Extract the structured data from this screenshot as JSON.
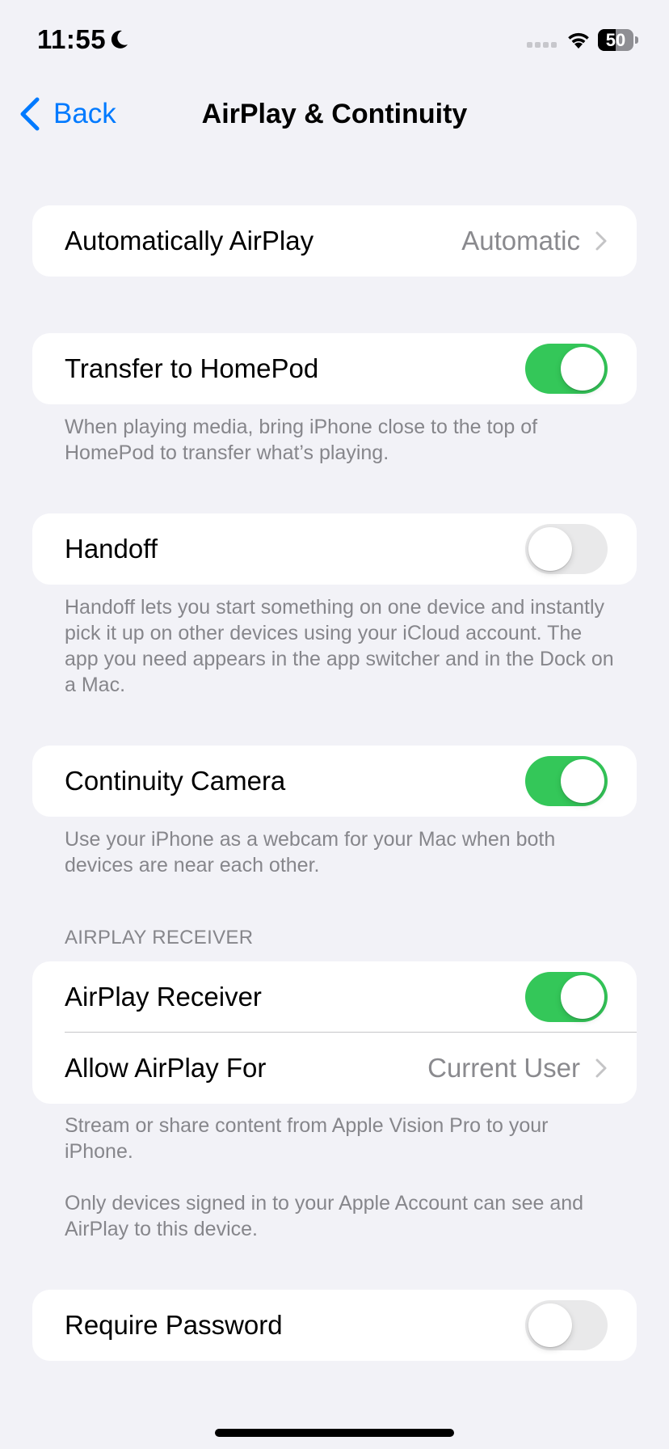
{
  "status_bar": {
    "time": "11:55",
    "focus_icon": "moon-icon",
    "signal_icon": "cellular-signal-icon",
    "wifi_icon": "wifi-icon",
    "battery_percent": "50",
    "battery_level": 0.5
  },
  "nav": {
    "back_label": "Back",
    "title": "AirPlay & Continuity"
  },
  "colors": {
    "accent": "#007AFF",
    "toggle_on": "#34C759",
    "toggle_off": "#E9E9EA",
    "background": "#F2F2F7",
    "secondary_text": "#86868B"
  },
  "automatically_airplay": {
    "label": "Automatically AirPlay",
    "value": "Automatic"
  },
  "transfer_homepod": {
    "label": "Transfer to HomePod",
    "enabled": true,
    "footer": "When playing media, bring iPhone close to the top of HomePod to transfer what’s playing."
  },
  "handoff": {
    "label": "Handoff",
    "enabled": false,
    "footer": "Handoff lets you start something on one device and instantly pick it up on other devices using your iCloud account. The app you need appears in the app switcher and in the Dock on a Mac."
  },
  "continuity_camera": {
    "label": "Continuity Camera",
    "enabled": true,
    "footer": "Use your iPhone as a webcam for your Mac when both devices are near each other."
  },
  "airplay_receiver_section": {
    "header": "AIRPLAY RECEIVER",
    "receiver_label": "AirPlay Receiver",
    "receiver_enabled": true,
    "allow_label": "Allow AirPlay For",
    "allow_value": "Current User",
    "footer_1": "Stream or share content from Apple Vision Pro to your iPhone.",
    "footer_2": "Only devices signed in to your Apple Account can see and AirPlay to this device."
  },
  "require_password": {
    "label": "Require Password",
    "enabled": false
  }
}
